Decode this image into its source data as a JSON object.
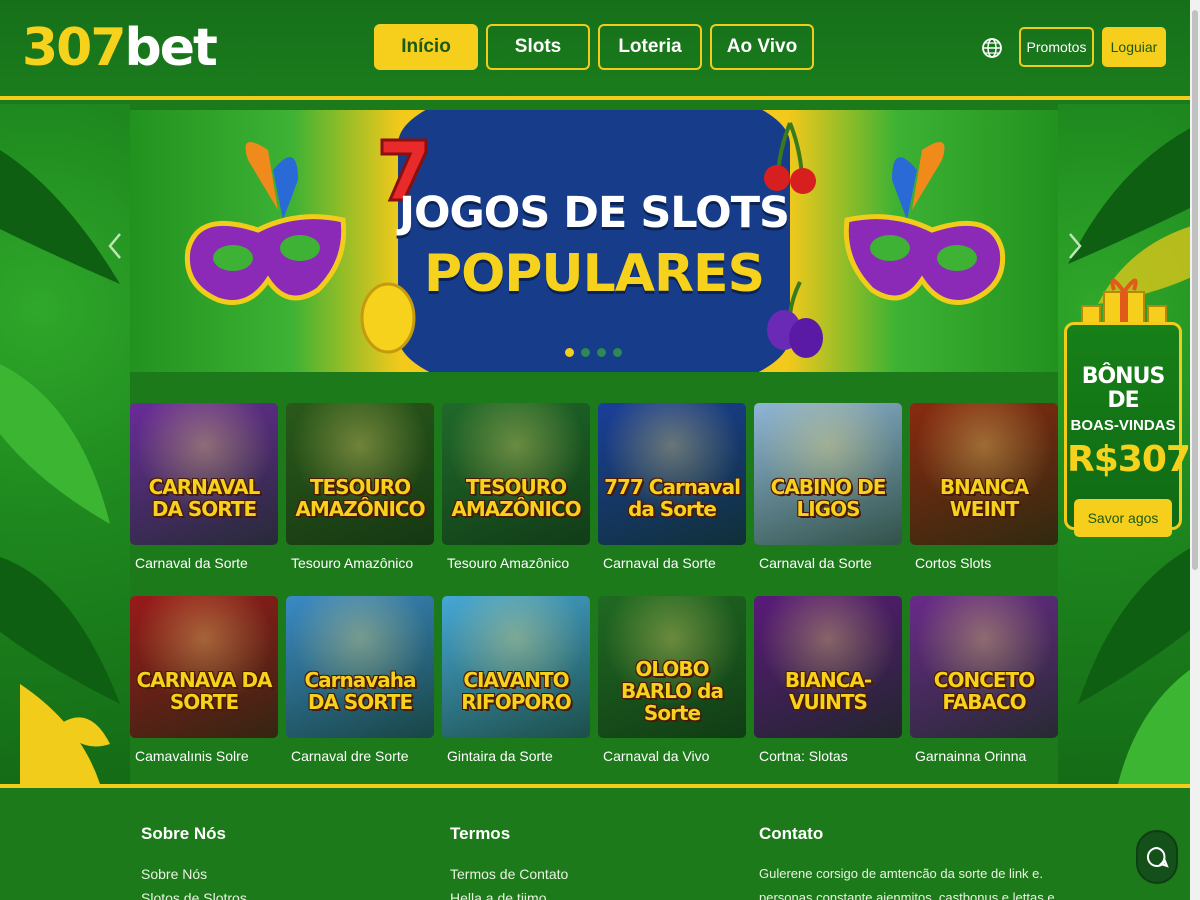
{
  "header": {
    "logo_num": "307",
    "logo_word": "bet",
    "nav": [
      "Início",
      "Slots",
      "Loteria",
      "Ao Vivo"
    ],
    "active_nav": "Início",
    "globe_icon": "globe-icon",
    "promo_label": "Promotos",
    "login_label": "Loguiar"
  },
  "hero": {
    "title_line1": "JOGOS DE SLOTS",
    "title_line2": "POPULARES",
    "slides": 4,
    "active_slide": 1
  },
  "bonus": {
    "title": "BÔNUS DE",
    "subtitle": "BOAS-VINDAS",
    "amount": "R$307",
    "button": "Savor agos"
  },
  "games": [
    {
      "thumb_title": "CARNAVAL DA SORTE",
      "label": "Carnaval da Sorte",
      "bg": "#6a2c9a"
    },
    {
      "thumb_title": "TESOURO AMAZÔNICO",
      "label": "Tesouro Amazônico",
      "bg": "#2b5a1a"
    },
    {
      "thumb_title": "TESOURO AMAZÔNICO",
      "label": "Tesouro Amazônico",
      "bg": "#1f6a2a"
    },
    {
      "thumb_title": "777 Carnaval da Sorte",
      "label": "Carnaval da Sorte",
      "bg": "#1a3f9a"
    },
    {
      "thumb_title": "CABINO DE LIGOS",
      "label": "Carnaval da Sorte",
      "bg": "#8fb6d6"
    },
    {
      "thumb_title": "BNANCA WEINT",
      "label": "Cortos Slots",
      "bg": "#8a2a10"
    },
    {
      "thumb_title": "CARNAVA DA SORTE",
      "label": "Camavalınis Solre",
      "bg": "#9a1a1a"
    },
    {
      "thumb_title": "Carnavaha DA SORTE",
      "label": "Carnaval dre Sorte",
      "bg": "#3a8ac6"
    },
    {
      "thumb_title": "CIAVANTO RIFOPORO",
      "label": "Gintaira da Sorte",
      "bg": "#46a8d6"
    },
    {
      "thumb_title": "OLOBO BARLO da Sorte",
      "label": "Carnaval da Vivo",
      "bg": "#1f6a22"
    },
    {
      "thumb_title": "BIANCA-VUINTS",
      "label": "Cortna: Slotas",
      "bg": "#5a1a7a"
    },
    {
      "thumb_title": "CONCETO FABACO",
      "label": "Garnainna Orinna",
      "bg": "#6a2a8a"
    }
  ],
  "footer": {
    "col1_title": "Sobre Nós",
    "col1_links": [
      "Sobre Nós",
      "Slotos de Slotros"
    ],
    "col2_title": "Termos",
    "col2_links": [
      "Termos de Contato",
      "Hella a de tiimo"
    ],
    "col3_title": "Contato",
    "col3_text": [
      "Gulerene corsigo de amtencão da sorte de link e.",
      "personas constante aienmitos, castbonus e lettas e"
    ]
  },
  "colors": {
    "brand_green": "#1d7a1a",
    "brand_yellow": "#f6cf1c",
    "banner_blue": "#163c8a"
  }
}
